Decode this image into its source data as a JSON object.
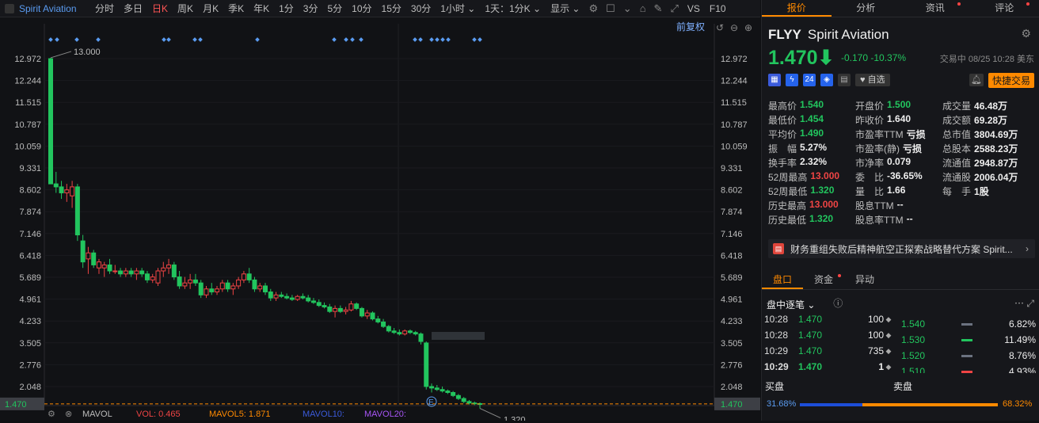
{
  "topbar": {
    "symbol": "Spirit Aviation",
    "tabs": [
      "分时",
      "多日",
      "日K",
      "周K",
      "月K",
      "季K",
      "年K",
      "1分",
      "3分",
      "5分",
      "10分",
      "15分",
      "30分",
      "1小时 ⌄",
      "1天：1分K ⌄"
    ],
    "active_tab": "日K",
    "display_label": "显示 ⌄",
    "vs_label": "VS",
    "f10_label": "F10"
  },
  "chart": {
    "adjust_label": "前复权",
    "high_marker": "13.000",
    "low_marker": "1.320",
    "last_price_tag": "1.470",
    "y_ticks": [
      "12.972",
      "12.244",
      "11.515",
      "10.787",
      "10.059",
      "9.331",
      "8.602",
      "7.874",
      "7.146",
      "6.418",
      "5.689",
      "4.961",
      "4.233",
      "3.505",
      "2.776",
      "2.048"
    ],
    "bottom_bar": {
      "mavol": "MAVOL",
      "vol": "VOL: 0.465",
      "mavol5": "MAVOL5: 1.871",
      "mavol10": "MAVOL10:",
      "mavol20": "MAVOL20:"
    }
  },
  "chart_data": {
    "type": "candlestick",
    "title": "",
    "ylim": [
      1.3,
      13.0
    ],
    "candles": [
      [
        12.97,
        13.0,
        9.9,
        8.8
      ],
      [
        8.8,
        9.2,
        8.5,
        8.7
      ],
      [
        8.7,
        8.9,
        8.3,
        8.5
      ],
      [
        8.5,
        8.8,
        8.2,
        8.6
      ],
      [
        8.4,
        8.9,
        8.0,
        8.7
      ],
      [
        8.7,
        8.8,
        6.9,
        7.1
      ],
      [
        6.9,
        7.1,
        6.0,
        6.2
      ],
      [
        6.3,
        6.7,
        5.8,
        6.5
      ],
      [
        6.5,
        6.6,
        6.0,
        6.1
      ],
      [
        6.0,
        6.3,
        5.8,
        6.2
      ],
      [
        6.0,
        6.2,
        5.7,
        6.1
      ],
      [
        6.1,
        6.3,
        5.8,
        5.9
      ],
      [
        5.9,
        6.1,
        5.8,
        5.9
      ],
      [
        5.9,
        6.0,
        5.7,
        5.8
      ],
      [
        5.8,
        6.0,
        5.7,
        5.9
      ],
      [
        5.9,
        6.0,
        5.7,
        5.8
      ],
      [
        5.8,
        6.0,
        5.6,
        5.9
      ],
      [
        5.9,
        6.0,
        5.7,
        5.8
      ],
      [
        5.8,
        5.9,
        5.5,
        5.6
      ],
      [
        5.6,
        5.8,
        5.5,
        5.7
      ],
      [
        5.5,
        6.0,
        5.4,
        5.9
      ],
      [
        5.9,
        6.2,
        5.7,
        6.0
      ],
      [
        6.0,
        6.3,
        5.8,
        6.1
      ],
      [
        6.1,
        6.2,
        5.6,
        5.7
      ],
      [
        5.7,
        5.9,
        5.3,
        5.4
      ],
      [
        5.4,
        5.7,
        5.3,
        5.5
      ],
      [
        5.5,
        5.8,
        5.3,
        5.6
      ],
      [
        5.6,
        5.8,
        5.4,
        5.5
      ],
      [
        5.5,
        5.6,
        5.0,
        5.1
      ],
      [
        5.1,
        5.4,
        5.0,
        5.3
      ],
      [
        5.3,
        5.5,
        5.1,
        5.2
      ],
      [
        5.2,
        5.4,
        5.1,
        5.3
      ],
      [
        5.3,
        5.6,
        5.2,
        5.5
      ],
      [
        5.5,
        5.6,
        5.2,
        5.3
      ],
      [
        5.3,
        5.5,
        5.1,
        5.4
      ],
      [
        5.4,
        5.7,
        5.3,
        5.6
      ],
      [
        5.6,
        5.9,
        5.5,
        5.8
      ],
      [
        5.8,
        6.0,
        5.5,
        5.6
      ],
      [
        5.6,
        5.7,
        5.2,
        5.3
      ],
      [
        5.3,
        5.5,
        5.2,
        5.4
      ],
      [
        5.4,
        5.5,
        5.1,
        5.2
      ],
      [
        5.2,
        5.3,
        4.9,
        5.0
      ],
      [
        5.0,
        5.2,
        4.9,
        5.1
      ],
      [
        5.1,
        5.2,
        5.0,
        5.05
      ],
      [
        5.05,
        5.15,
        4.95,
        5.0
      ],
      [
        5.0,
        5.1,
        4.9,
        4.95
      ],
      [
        4.95,
        5.1,
        4.9,
        5.05
      ],
      [
        5.05,
        5.15,
        4.95,
        5.0
      ],
      [
        5.0,
        5.1,
        4.85,
        4.9
      ],
      [
        4.9,
        5.0,
        4.8,
        4.85
      ],
      [
        4.85,
        4.95,
        4.7,
        4.75
      ],
      [
        4.75,
        4.85,
        4.65,
        4.7
      ],
      [
        4.7,
        4.8,
        4.5,
        4.55
      ],
      [
        4.55,
        4.75,
        4.35,
        4.65
      ],
      [
        4.65,
        4.75,
        4.5,
        4.55
      ],
      [
        4.55,
        4.7,
        4.45,
        4.6
      ],
      [
        4.6,
        4.9,
        4.55,
        4.8
      ],
      [
        4.8,
        4.85,
        4.6,
        4.65
      ],
      [
        4.65,
        4.7,
        4.35,
        4.4
      ],
      [
        4.4,
        4.6,
        4.3,
        4.5
      ],
      [
        4.5,
        4.55,
        4.25,
        4.3
      ],
      [
        4.3,
        4.4,
        4.15,
        4.2
      ],
      [
        4.2,
        4.3,
        4.0,
        4.05
      ],
      [
        4.05,
        4.1,
        3.85,
        3.9
      ],
      [
        3.9,
        4.0,
        3.8,
        3.85
      ],
      [
        3.85,
        3.95,
        3.75,
        3.8
      ],
      [
        3.8,
        3.95,
        3.75,
        3.9
      ],
      [
        3.9,
        3.95,
        3.8,
        3.85
      ],
      [
        3.85,
        3.9,
        3.75,
        3.8
      ],
      [
        3.8,
        3.85,
        3.45,
        3.55
      ],
      [
        3.5,
        3.55,
        1.95,
        2.05
      ],
      [
        2.05,
        2.15,
        1.85,
        2.0
      ],
      [
        2.0,
        2.1,
        1.9,
        1.95
      ],
      [
        1.95,
        2.05,
        1.85,
        1.9
      ],
      [
        1.9,
        1.95,
        1.8,
        1.85
      ],
      [
        1.85,
        1.9,
        1.7,
        1.75
      ],
      [
        1.75,
        1.8,
        1.6,
        1.65
      ],
      [
        1.65,
        1.7,
        1.5,
        1.55
      ],
      [
        1.55,
        1.6,
        1.45,
        1.5
      ],
      [
        1.5,
        1.55,
        1.43,
        1.48
      ],
      [
        1.48,
        1.52,
        1.32,
        1.47
      ]
    ],
    "last_price": 1.47
  },
  "quote": {
    "code": "FLYY",
    "name": "Spirit Aviation",
    "price": "1.470⬇",
    "change": "-0.170  -10.37%",
    "trade_time": "交易中 08/25 10:28 美东",
    "zixuan": "自选",
    "quick_trade": "快捷交易",
    "stats": [
      [
        [
          "最高价",
          "1.540",
          "#22c55e"
        ],
        [
          "开盘价",
          "1.500",
          "#22c55e"
        ],
        [
          "成交量",
          "46.48万",
          "#eee"
        ]
      ],
      [
        [
          "最低价",
          "1.454",
          "#22c55e"
        ],
        [
          "昨收价",
          "1.640",
          "#eee"
        ],
        [
          "成交额",
          "69.28万",
          "#eee"
        ]
      ],
      [
        [
          "平均价",
          "1.490",
          "#22c55e"
        ],
        [
          "市盈率TTM",
          "亏损",
          "#eee"
        ],
        [
          "总市值",
          "3804.69万",
          "#eee"
        ]
      ],
      [
        [
          "振　幅",
          "5.27%",
          "#eee"
        ],
        [
          "市盈率(静)",
          "亏损",
          "#eee"
        ],
        [
          "总股本",
          "2588.23万",
          "#eee"
        ]
      ],
      [
        [
          "换手率",
          "2.32%",
          "#eee"
        ],
        [
          "市净率",
          "0.079",
          "#eee"
        ],
        [
          "流通值",
          "2948.87万",
          "#eee"
        ]
      ],
      [
        [
          "52周最高",
          "13.000",
          "#ef4444"
        ],
        [
          "委　比",
          "-36.65%",
          "#eee"
        ],
        [
          "流通股",
          "2006.04万",
          "#eee"
        ]
      ],
      [
        [
          "52周最低",
          "1.320",
          "#22c55e"
        ],
        [
          "量　比",
          "1.66",
          "#eee"
        ],
        [
          "每　手",
          "1股",
          "#eee"
        ]
      ],
      [
        [
          "历史最高",
          "13.000",
          "#ef4444"
        ],
        [
          "股息TTM",
          "--",
          "#eee"
        ],
        [
          "",
          "",
          "#eee"
        ]
      ],
      [
        [
          "历史最低",
          "1.320",
          "#22c55e"
        ],
        [
          "股息率TTM",
          "--",
          "#eee"
        ],
        [
          "",
          "",
          "#eee"
        ]
      ]
    ],
    "news": "财务重组失败后精神航空正探索战略替代方案 Spirit...",
    "right_tabs": [
      "报价",
      "分析",
      "资讯",
      "评论"
    ],
    "lower_tabs": [
      "盘口",
      "资金",
      "异动"
    ],
    "tick_title": "盘中逐笔 ⌄",
    "ticks": [
      [
        "10:28",
        "1.470",
        "100",
        "◆"
      ],
      [
        "10:28",
        "1.470",
        "100",
        "◆"
      ],
      [
        "10:29",
        "1.470",
        "735",
        "◆"
      ],
      [
        "10:29",
        "1.470",
        "1",
        "◆"
      ]
    ],
    "levels": [
      [
        "1.540",
        "6.82%",
        "#6b7280"
      ],
      [
        "1.530",
        "11.49%",
        "#22c55e"
      ],
      [
        "1.520",
        "8.76%",
        "#6b7280"
      ],
      [
        "1.510",
        "4.93%",
        "#ef4444"
      ]
    ],
    "buy_label": "买盘",
    "sell_label": "卖盘",
    "buy_pct": "31.68%",
    "sell_pct": "68.32%",
    "sell_fraction": 0.6832
  }
}
